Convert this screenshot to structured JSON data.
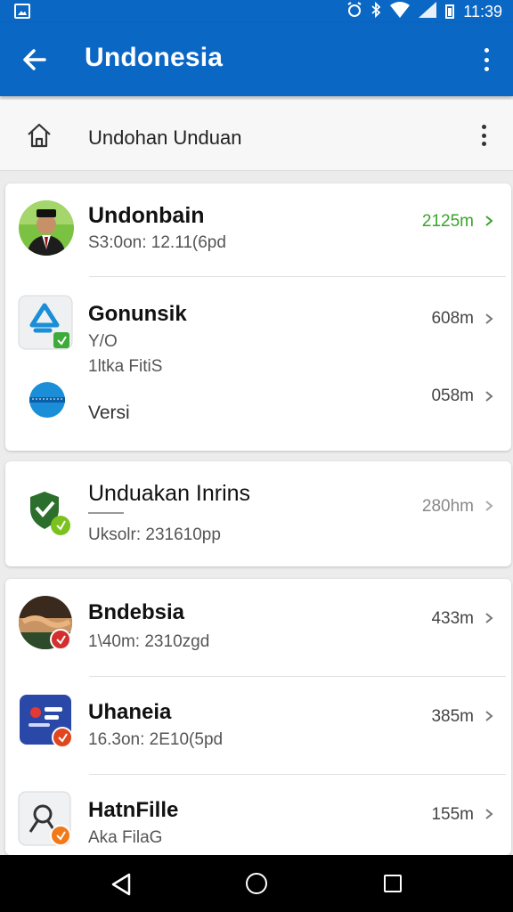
{
  "status_bar": {
    "time": "11:39",
    "icons": [
      "gallery-icon",
      "alarm-icon",
      "bluetooth-icon",
      "wifi-icon",
      "signal-icon",
      "battery-icon"
    ]
  },
  "app_bar": {
    "title": "Undonesia",
    "back_icon": "arrow-left-icon",
    "menu_icon": "more-vert-icon",
    "background": "#0a67c4"
  },
  "subheader": {
    "label": "Undohan Unduan",
    "home_icon": "home-icon",
    "menu_icon": "more-vert-icon"
  },
  "groups": [
    {
      "items": [
        {
          "name": "Undonbain",
          "detail": "S3:0on: 12.11(6pd",
          "detail2": "",
          "size": "2125m",
          "size_color": "#3aa52a"
        },
        {
          "name": "Gonunsik",
          "detail": "Y/O",
          "detail2": "1ltka FitiS",
          "size": "608m"
        },
        {
          "name": "",
          "detail": "Versi",
          "size": "058m"
        }
      ]
    },
    {
      "items": [
        {
          "name": "Unduakan Inrins",
          "detail": "Uksolr: 231610pp",
          "size": "280hm"
        }
      ]
    },
    {
      "items": [
        {
          "name": "Bndebsia",
          "detail": "1\\40m: 2310zgd",
          "size": "433m"
        },
        {
          "name": "Uhaneia",
          "detail": "16.3on: 2E10(5pd",
          "size": "385m"
        },
        {
          "name": "HatnFille",
          "detail": "Aka FilaG",
          "size": "155m"
        }
      ]
    }
  ],
  "nav_bar": {
    "icons": [
      "nav-back-icon",
      "nav-home-icon",
      "nav-recents-icon"
    ]
  }
}
